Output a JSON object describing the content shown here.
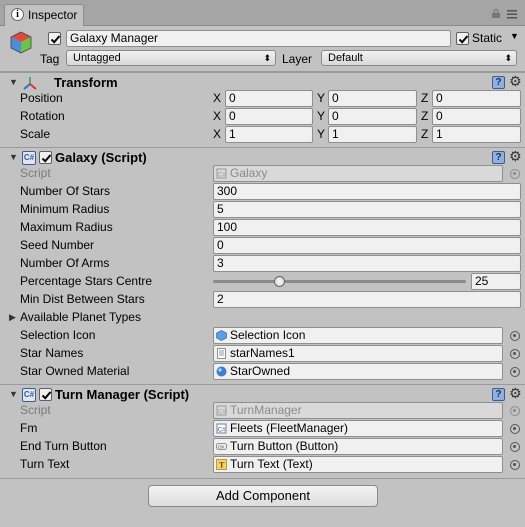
{
  "tab": {
    "label": "Inspector",
    "icon": "info-icon"
  },
  "header": {
    "object_name": "Galaxy Manager",
    "active_checked": true,
    "static_label": "Static",
    "static_checked": true,
    "tag_label": "Tag",
    "tag_value": "Untagged",
    "layer_label": "Layer",
    "layer_value": "Default"
  },
  "transform": {
    "title": "Transform",
    "rows": [
      {
        "label": "Position",
        "x": "0",
        "y": "0",
        "z": "0"
      },
      {
        "label": "Rotation",
        "x": "0",
        "y": "0",
        "z": "0"
      },
      {
        "label": "Scale",
        "x": "1",
        "y": "1",
        "z": "1"
      }
    ],
    "axis": {
      "x": "X",
      "y": "Y",
      "z": "Z"
    }
  },
  "galaxy": {
    "title": "Galaxy (Script)",
    "script_label": "Script",
    "script_value": "Galaxy",
    "fields": [
      {
        "label": "Number Of Stars",
        "value": "300"
      },
      {
        "label": "Minimum Radius",
        "value": "5"
      },
      {
        "label": "Maximum Radius",
        "value": "100"
      },
      {
        "label": "Seed Number",
        "value": "0"
      },
      {
        "label": "Number Of Arms",
        "value": "3"
      }
    ],
    "percentage_label": "Percentage Stars Centre",
    "percentage_value": "25",
    "percentage_fraction": 0.25,
    "min_dist_label": "Min Dist Between Stars",
    "min_dist_value": "2",
    "planet_types_label": "Available Planet Types",
    "selection_icon_label": "Selection Icon",
    "selection_icon_value": "Selection Icon",
    "star_names_label": "Star Names",
    "star_names_value": "starNames1",
    "star_material_label": "Star Owned Material",
    "star_material_value": "StarOwned"
  },
  "turn_manager": {
    "title": "Turn Manager (Script)",
    "script_label": "Script",
    "script_value": "TurnManager",
    "fm_label": "Fm",
    "fm_value": "Fleets (FleetManager)",
    "end_turn_label": "End Turn Button",
    "end_turn_value": "Turn Button (Button)",
    "turn_text_label": "Turn Text",
    "turn_text_value": "Turn Text (Text)"
  },
  "add_component_label": "Add Component",
  "colors": {
    "panel": "#c2c2c2",
    "field": "#f0f0f0",
    "help": "#8fb0e0",
    "sphere": "#3f7fd0"
  }
}
